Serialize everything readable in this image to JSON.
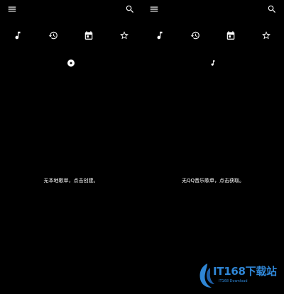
{
  "panels": [
    {
      "id": "local",
      "icons": {
        "menu": "menu-icon",
        "search": "search-icon",
        "tabs": [
          "music-note-icon",
          "history-icon",
          "calendar-icon",
          "star-icon"
        ],
        "sub_indicator": "disc-icon"
      },
      "empty_message": "无本地歌单，点击创建。"
    },
    {
      "id": "qq",
      "icons": {
        "menu": "menu-icon",
        "search": "search-icon",
        "tabs": [
          "music-note-icon",
          "history-icon",
          "calendar-icon",
          "star-icon"
        ],
        "sub_indicator": "small-music-note-icon"
      },
      "empty_message": "无QQ音乐歌单，点击获取。"
    }
  ],
  "watermark": {
    "text": "IT168下载站",
    "subtext": "IT168 Download",
    "color": "#2f86d6"
  },
  "colors": {
    "background": "#000000",
    "foreground": "#ffffff"
  }
}
